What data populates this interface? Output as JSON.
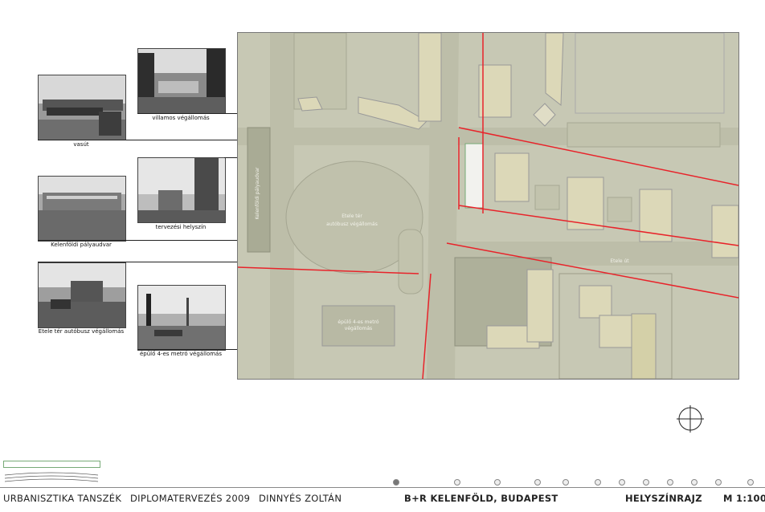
{
  "photos": {
    "vasut": "vasút",
    "villamos": "villamos végállomás",
    "kelenfoldi": "Kelenföldi pályaudvar",
    "tervezesi": "tervezési helyszín",
    "etele_busz": "Etele tér autóbusz végállomás",
    "metro": "épülő 4-es metró végállomás"
  },
  "map_labels": {
    "etele_ter": "Etele tér",
    "busz_vegallomas": "autóbusz végállomás",
    "metro_1": "épülő 4-es metró",
    "metro_2": "végállomás",
    "etele_ut": "Etele út",
    "kelenfoldi_palyaudvar": "Kelenföldi pályaudvar"
  },
  "footer": {
    "dept": "URBANISZTIKA TANSZÉK",
    "course": "DIPLOMATERVEZÉS 2009",
    "author": "DINNYÉS ZOLTÁN",
    "project": "B+R KELENFÖLD, BUDAPEST",
    "sheet": "HELYSZÍNRAJZ",
    "scale": "M 1:100"
  },
  "colors": {
    "map_background": "#c7c8b4",
    "building": "#dcd8b8",
    "road_red": "#e8232a"
  }
}
